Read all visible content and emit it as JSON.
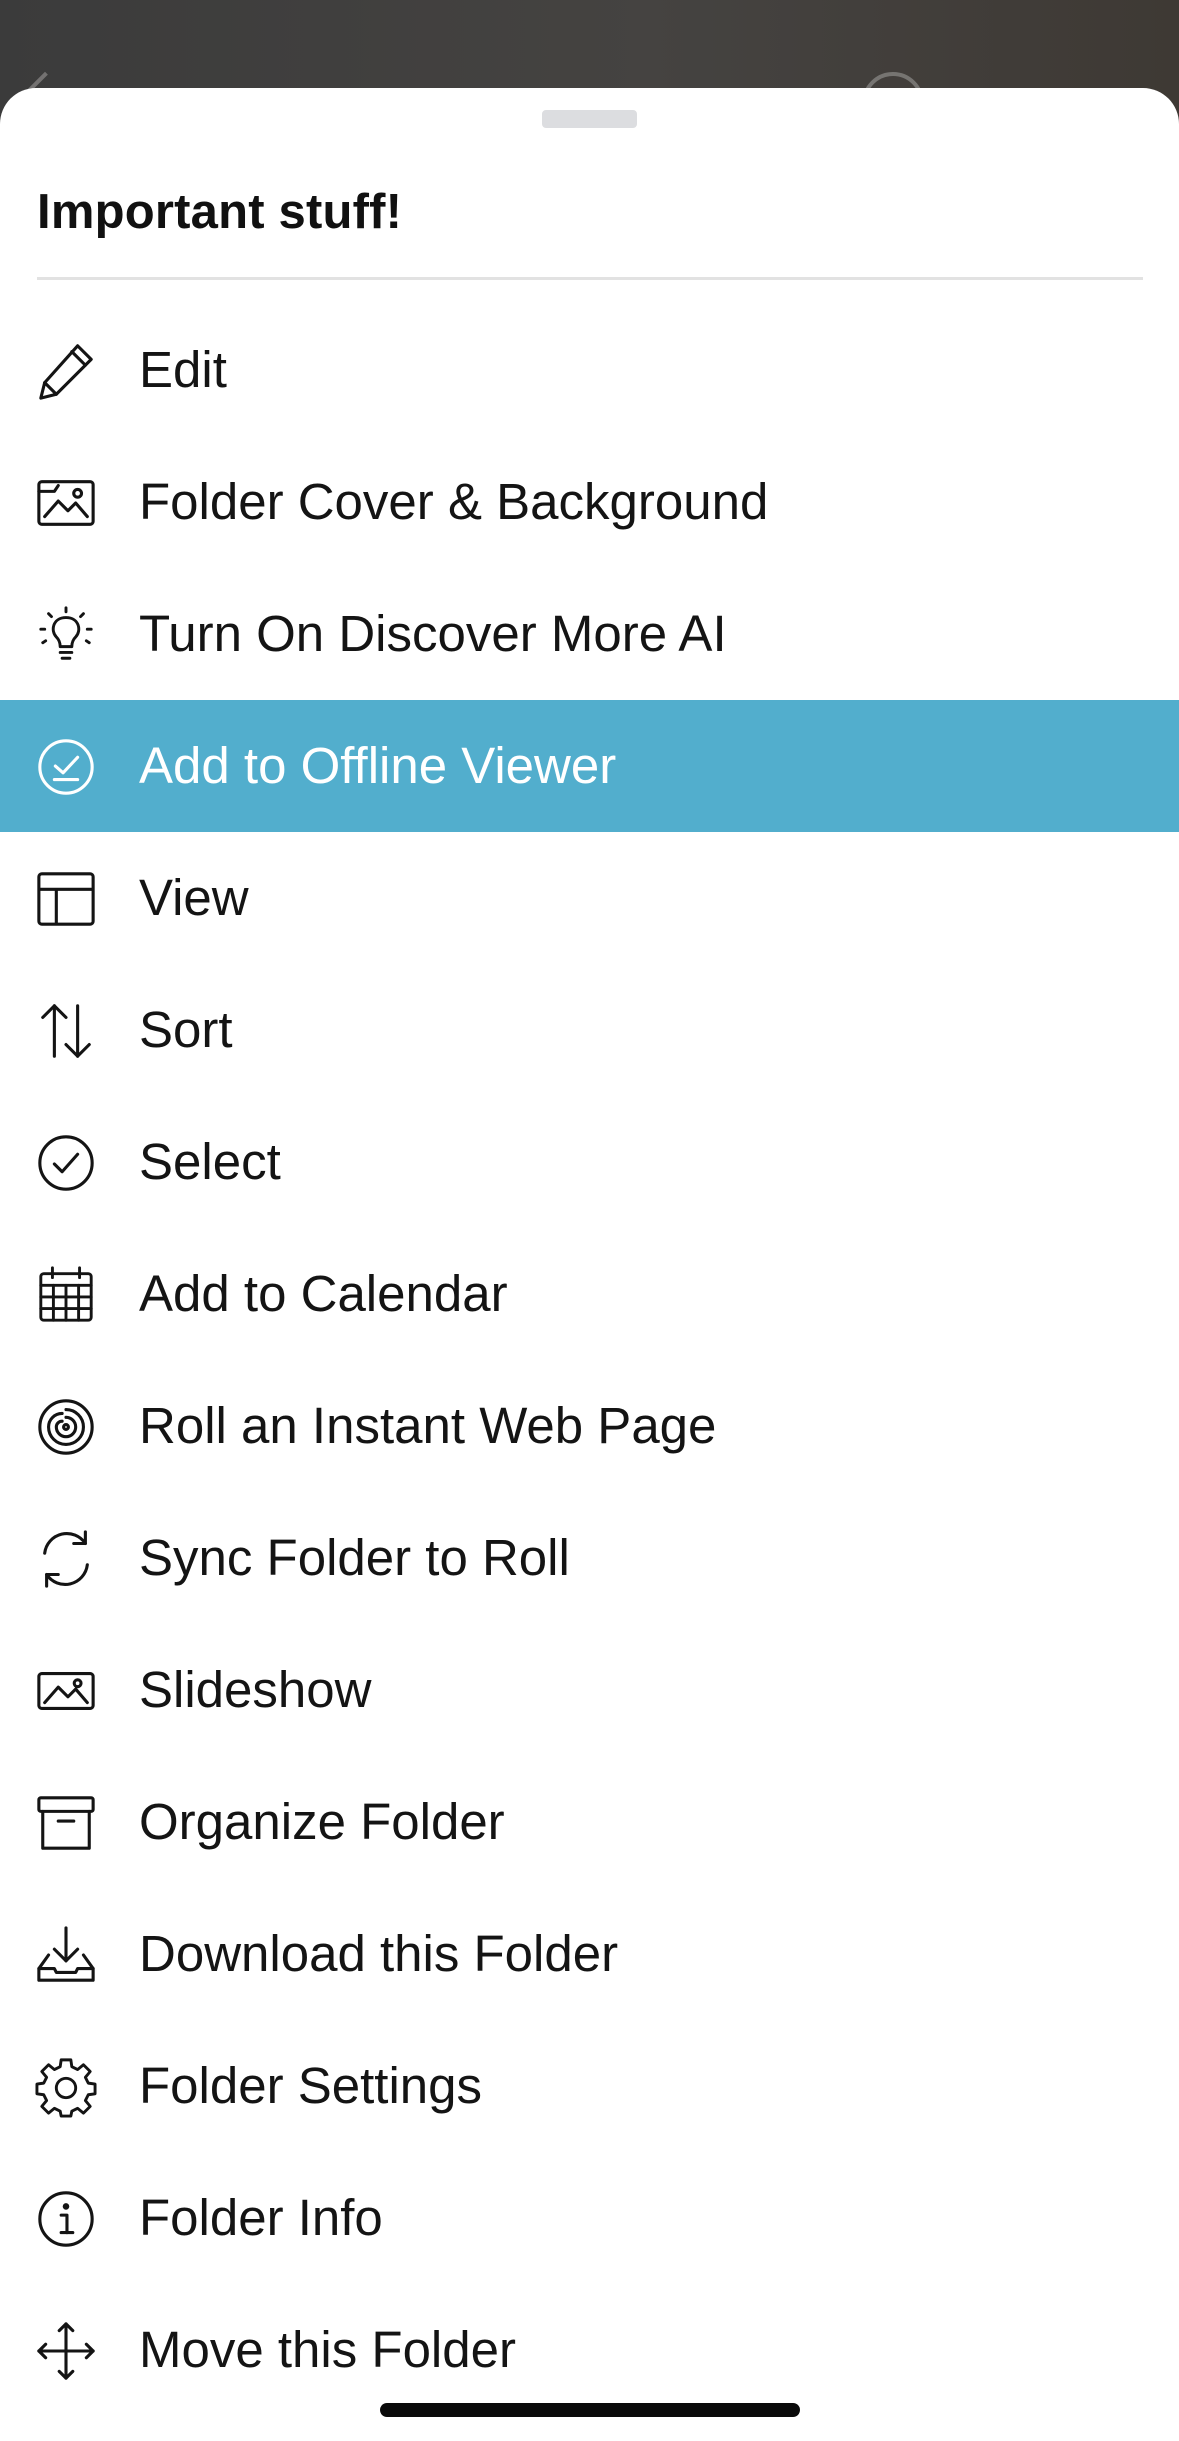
{
  "sheet": {
    "title": "Important stuff!"
  },
  "menu": {
    "items": [
      {
        "label": "Edit",
        "icon": "pencil-icon"
      },
      {
        "label": "Folder Cover & Background",
        "icon": "image-frame-icon"
      },
      {
        "label": "Turn On Discover More AI",
        "icon": "lightbulb-icon"
      },
      {
        "label": "Add to Offline Viewer",
        "icon": "offline-check-icon",
        "highlighted": true
      },
      {
        "label": "View",
        "icon": "layout-icon"
      },
      {
        "label": "Sort",
        "icon": "sort-arrows-icon"
      },
      {
        "label": "Select",
        "icon": "check-circle-icon"
      },
      {
        "label": "Add to Calendar",
        "icon": "calendar-icon"
      },
      {
        "label": "Roll an Instant Web Page",
        "icon": "spiral-icon"
      },
      {
        "label": "Sync Folder to Roll",
        "icon": "sync-icon"
      },
      {
        "label": "Slideshow",
        "icon": "slideshow-icon"
      },
      {
        "label": "Organize Folder",
        "icon": "archive-box-icon"
      },
      {
        "label": "Download this Folder",
        "icon": "download-tray-icon"
      },
      {
        "label": "Folder Settings",
        "icon": "gear-icon"
      },
      {
        "label": "Folder Info",
        "icon": "info-icon"
      },
      {
        "label": "Move this Folder",
        "icon": "move-arrows-icon"
      },
      {
        "label": "",
        "icon": "trash-icon"
      }
    ]
  },
  "colors": {
    "highlight": "#52aecd",
    "text": "#141414",
    "sheet_background": "#ffffff",
    "backdrop": "#3a3836"
  }
}
